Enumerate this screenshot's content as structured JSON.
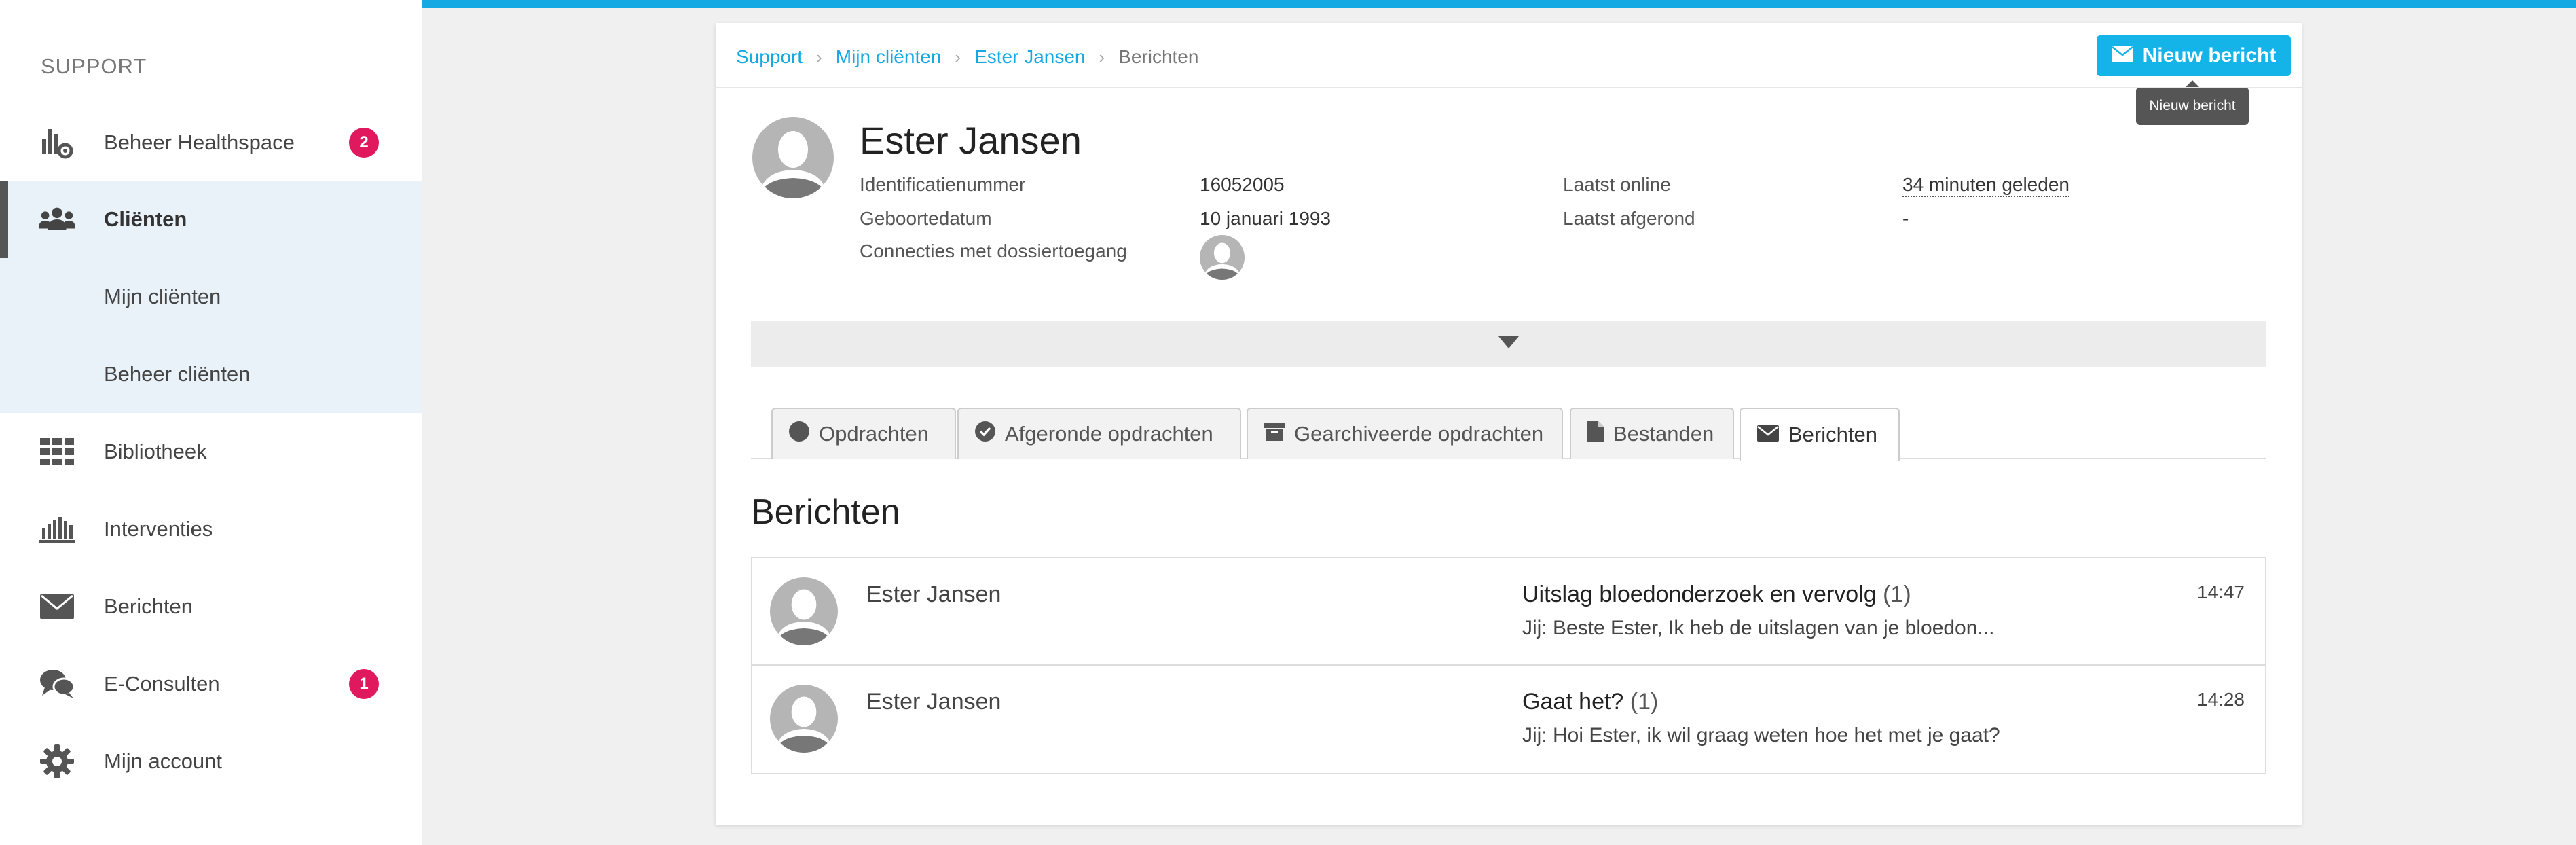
{
  "sidebar": {
    "header": "SUPPORT",
    "items": [
      {
        "label": "Beheer Healthspace",
        "icon": "healthspace-gear-icon",
        "badge": "2"
      },
      {
        "label": "Cliënten",
        "icon": "users-icon"
      },
      {
        "label": "Mijn cliënten"
      },
      {
        "label": "Beheer cliënten"
      },
      {
        "label": "Bibliotheek",
        "icon": "grid-icon"
      },
      {
        "label": "Interventies",
        "icon": "interventions-icon"
      },
      {
        "label": "Berichten",
        "icon": "envelope-icon"
      },
      {
        "label": "E-Consulten",
        "icon": "chat-bubbles-icon",
        "badge": "1"
      },
      {
        "label": "Mijn account",
        "icon": "gear-icon"
      }
    ]
  },
  "breadcrumb": {
    "items": [
      "Support",
      "Mijn cliënten",
      "Ester Jansen"
    ],
    "current": "Berichten"
  },
  "new_message_button": {
    "label": "Nieuw bericht",
    "tooltip": "Nieuw bericht"
  },
  "profile": {
    "name": "Ester Jansen",
    "id_label": "Identificatienummer",
    "id_value": "16052005",
    "dob_label": "Geboortedatum",
    "dob_value": "10 januari 1993",
    "connections_label": "Connecties met dossiertoegang",
    "last_online_label": "Laatst online",
    "last_online_value": "34 minuten geleden",
    "last_completed_label": "Laatst afgerond",
    "last_completed_value": "-"
  },
  "tabs": [
    {
      "label": "Opdrachten",
      "icon": "circle-icon"
    },
    {
      "label": "Afgeronde opdrachten",
      "icon": "check-circle-icon"
    },
    {
      "label": "Gearchiveerde opdrachten",
      "icon": "archive-icon"
    },
    {
      "label": "Bestanden",
      "icon": "file-icon"
    },
    {
      "label": "Berichten",
      "icon": "envelope-icon",
      "active": true
    }
  ],
  "section_title": "Berichten",
  "messages": [
    {
      "sender": "Ester Jansen",
      "subject": "Uitslag bloedonderzoek en vervolg",
      "count": "(1)",
      "preview": "Jij: Beste Ester, Ik heb de uitslagen van je bloedon...",
      "time": "14:47"
    },
    {
      "sender": "Ester Jansen",
      "subject": "Gaat het?",
      "count": "(1)",
      "preview": "Jij: Hoi Ester, ik wil graag weten hoe het met je gaat?",
      "time": "14:28"
    }
  ],
  "colors": {
    "accent": "#14a9e2",
    "badge": "#e0195f",
    "active_bg": "#e9f2f9"
  }
}
